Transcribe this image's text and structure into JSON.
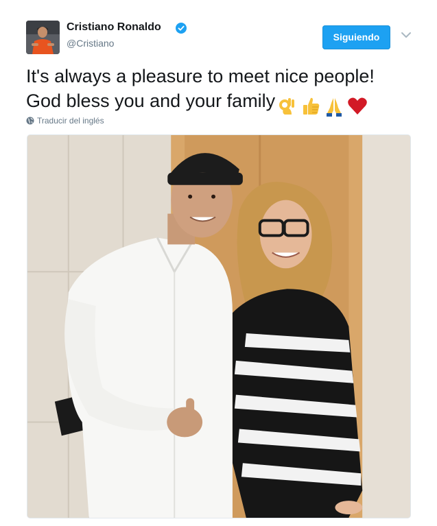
{
  "tweet": {
    "author": {
      "name": "Cristiano Ronaldo",
      "handle": "@Cristiano",
      "verified": true
    },
    "follow_button": "Siguiendo",
    "text_line1": "It's always a pleasure to meet nice people!",
    "text_line2": "God bless you and your family",
    "emojis": [
      "ok-hand-icon",
      "thumbs-up-icon",
      "folded-hands-icon",
      "red-heart-icon"
    ],
    "translate_label": "Traducir del inglés"
  },
  "colors": {
    "accent": "#1da1f2",
    "secondary_text": "#657786"
  },
  "icons": {
    "verified": "verified-badge-icon",
    "caret": "chevron-down-icon",
    "globe": "globe-icon"
  }
}
